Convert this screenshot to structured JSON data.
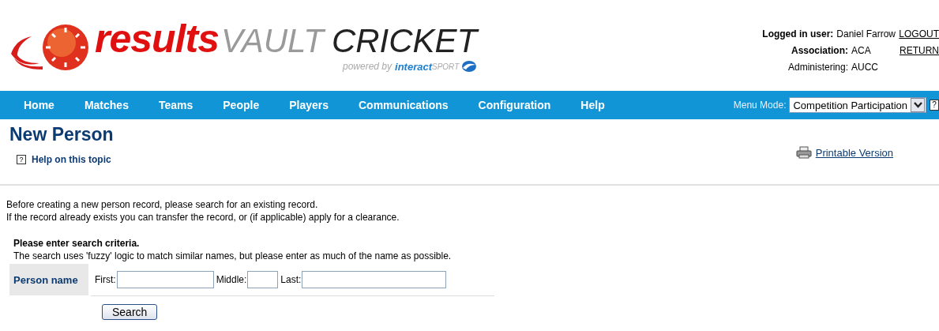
{
  "logo": {
    "word_1": "results",
    "word_2": "VAULT",
    "word_3": "CRICKET",
    "powered_by": "powered by",
    "brand_1": "interact",
    "brand_2": "SPORT"
  },
  "user_info": {
    "user_label": "Logged in user:",
    "user_value": "Daniel Farrow",
    "logout": "LOGOUT",
    "association_label": "Association:",
    "association_value": "ACA",
    "return": "RETURN",
    "administering_label": "Administering:",
    "administering_value": "AUCC"
  },
  "nav": {
    "items": [
      {
        "label": "Home"
      },
      {
        "label": "Matches"
      },
      {
        "label": "Teams"
      },
      {
        "label": "People"
      },
      {
        "label": "Players"
      },
      {
        "label": "Communications"
      },
      {
        "label": "Configuration"
      },
      {
        "label": "Help"
      }
    ],
    "menu_mode_label": "Menu Mode:",
    "menu_mode_value": "Competition Participation",
    "help_glyph": "?"
  },
  "page": {
    "title": "New Person",
    "help_glyph": "?",
    "help_link": "Help on this topic",
    "printable_link": "Printable Version",
    "intro": [
      "Before creating a new person record, please search for an existing record.",
      "If the record already exists you can transfer the record, or (if applicable) apply for a clearance."
    ],
    "criteria_title": "Please enter search criteria.",
    "criteria_note": "The search uses 'fuzzy' logic to match similar names, but please enter as much of the name as possible.",
    "person_name_label": "Person name",
    "fields": [
      {
        "label": "First:"
      },
      {
        "label": "Middle:"
      },
      {
        "label": "Last:"
      }
    ],
    "search_button": "Search"
  }
}
